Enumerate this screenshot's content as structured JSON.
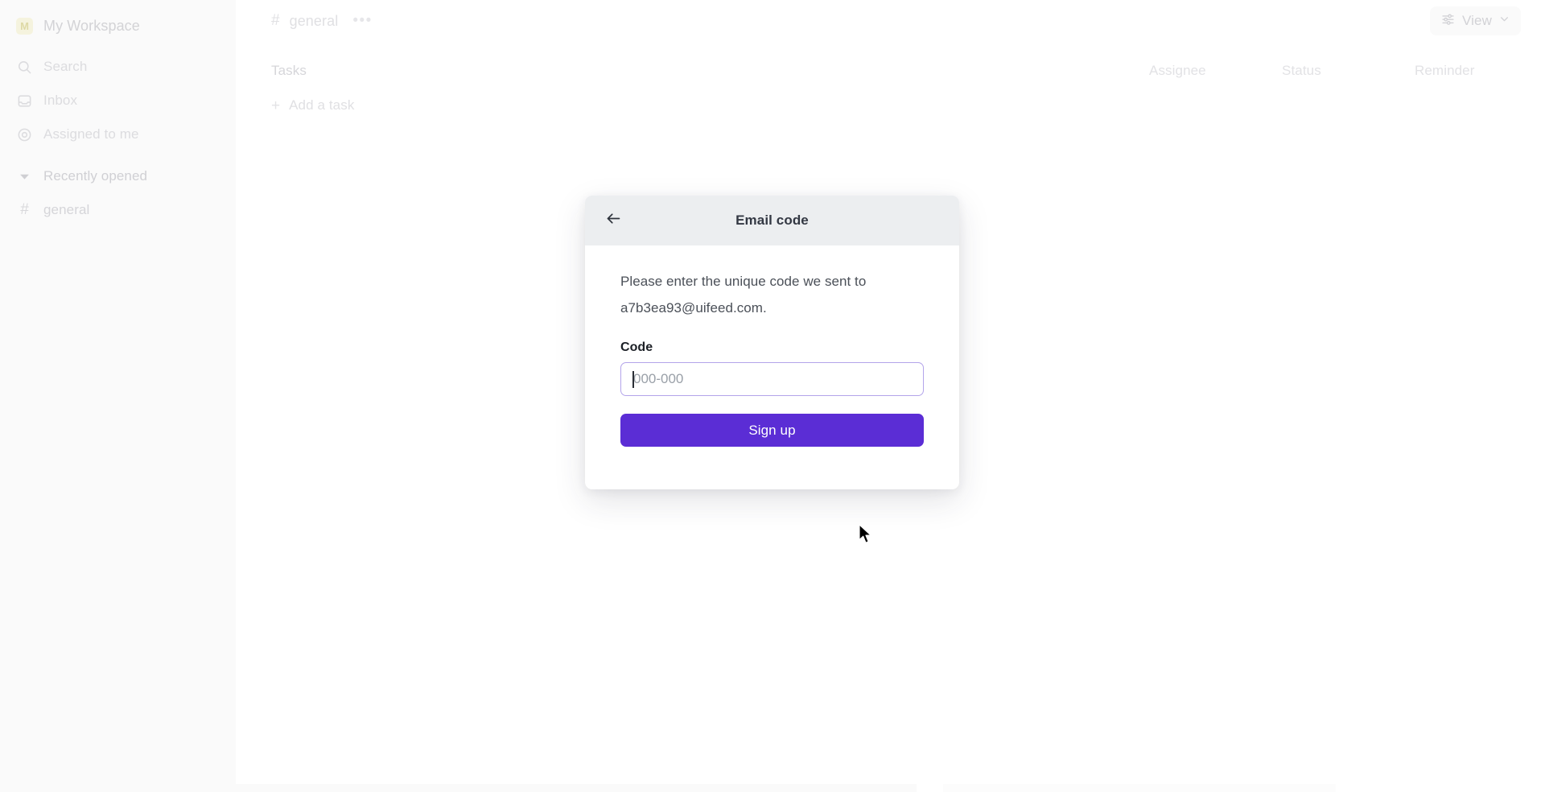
{
  "sidebar": {
    "workspace": {
      "initial": "M",
      "name": "My Workspace"
    },
    "items": [
      {
        "label": "Search",
        "icon": "search-icon"
      },
      {
        "label": "Inbox",
        "icon": "inbox-icon"
      },
      {
        "label": "Assigned to me",
        "icon": "target-icon"
      }
    ],
    "section": {
      "label": "Recently opened",
      "icon": "caret-down-icon"
    },
    "channels": [
      {
        "label": "general",
        "icon": "hash-icon"
      }
    ]
  },
  "topbar": {
    "breadcrumb_hash": "#",
    "breadcrumb_name": "general",
    "more_dots": "•••",
    "view_label": "View",
    "view_icon": "sliders-icon",
    "view_chevron": "chevron-down-icon"
  },
  "list": {
    "tasks_label": "Tasks",
    "columns": [
      "Assignee",
      "Status",
      "Reminder"
    ],
    "add_task_plus": "+",
    "add_task_label": "Add a task"
  },
  "modal": {
    "title": "Email code",
    "back_icon": "arrow-left-icon",
    "description": "Please enter the unique code we sent to a7b3ea93@uifeed.com.",
    "field_label": "Code",
    "code_value": "",
    "code_placeholder": "000-000",
    "submit_label": "Sign up"
  },
  "colors": {
    "accent_purple": "#5b2dd5",
    "input_border_focus": "#b3a4ea",
    "modal_header_bg": "#eceef0",
    "sidebar_bg": "#fafafa"
  }
}
